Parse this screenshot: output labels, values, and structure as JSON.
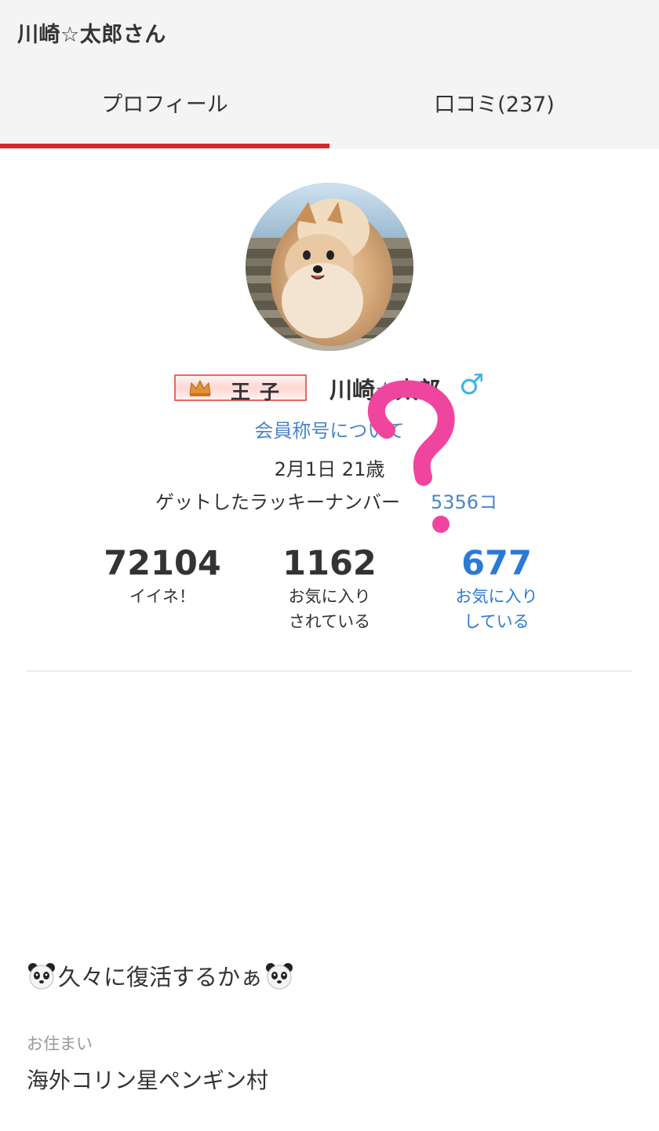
{
  "header": {
    "title": "川崎☆太郎さん"
  },
  "tabs": [
    {
      "label": "プロフィール",
      "active": true
    },
    {
      "label": "口コミ(237)",
      "active": false
    }
  ],
  "profile": {
    "badge_label": "王子",
    "badge_icon": "crown-icon",
    "username": "川崎☆太郎",
    "gender_symbol": "♂",
    "title_link": "会員称号について",
    "birthday_age": "2月1日 21歳",
    "lucky_number_label": "ゲットしたラッキーナンバー",
    "lucky_number_value": "5356コ"
  },
  "stats": [
    {
      "number": "72104",
      "label": "イイネ！"
    },
    {
      "number": "1162",
      "label": "お気に入り\nされている"
    },
    {
      "number": "677",
      "label": "お気に入り\nしている"
    }
  ],
  "bio": {
    "text": "久々に復活するかぁ",
    "icon": "panda-icon"
  },
  "residence": {
    "label": "お住まい",
    "value": "海外コリン星ペンギン村"
  },
  "colors": {
    "accent_red": "#d8252a",
    "link_blue": "#4a86c7",
    "stat_blue": "#2a7ad5",
    "gender_blue": "#41b4e8",
    "scribble_pink": "#f0459f"
  }
}
